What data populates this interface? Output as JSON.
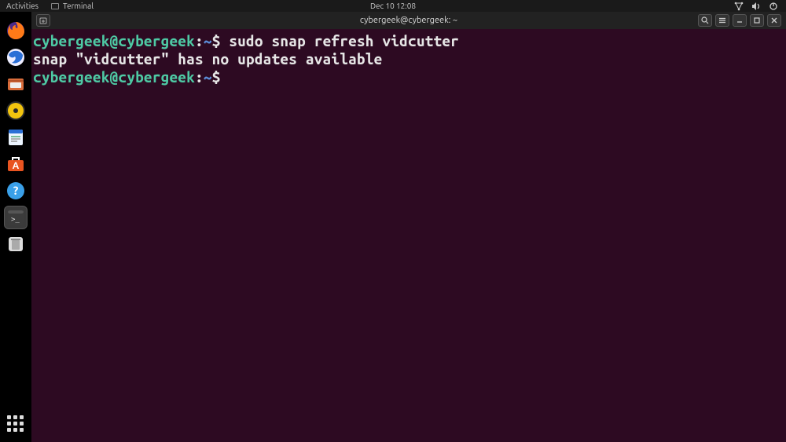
{
  "top_panel": {
    "activities": "Activities",
    "app_label": "Terminal",
    "datetime": "Dec 10  12:08"
  },
  "window": {
    "title": "cybergeek@cybergeek: ~"
  },
  "terminal": {
    "prompt_user": "cybergeek@cybergeek",
    "prompt_sep1": ":",
    "prompt_path": "~",
    "prompt_sep2": "$",
    "lines": [
      {
        "cmd": "sudo snap refresh vidcutter"
      },
      {
        "output": "snap \"vidcutter\" has no updates available"
      },
      {
        "cmd": ""
      }
    ]
  },
  "dock": {
    "items": [
      {
        "name": "firefox"
      },
      {
        "name": "thunderbird"
      },
      {
        "name": "files"
      },
      {
        "name": "rhythmbox"
      },
      {
        "name": "libreoffice-writer"
      },
      {
        "name": "ubuntu-software"
      },
      {
        "name": "help"
      },
      {
        "name": "terminal"
      },
      {
        "name": "trash"
      }
    ]
  }
}
